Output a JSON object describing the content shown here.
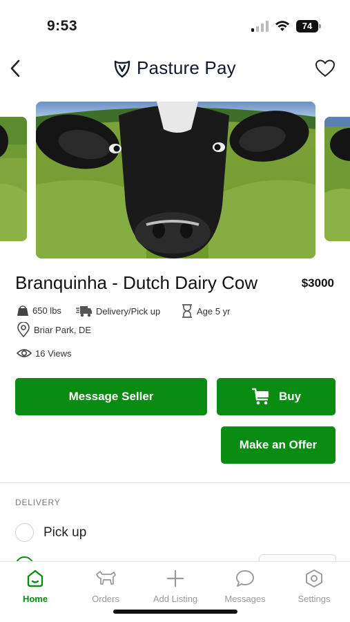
{
  "status_bar": {
    "time": "9:53",
    "battery": "74"
  },
  "header": {
    "brand_name": "Pasture Pay",
    "back_icon": "chevron-left-icon",
    "favorite_icon": "heart-outline-icon",
    "logo_icon": "cow-shield-icon"
  },
  "listing": {
    "title": "Branquinha - Dutch Dairy Cow",
    "price": "$3000",
    "weight": "650 lbs",
    "delivery": "Delivery/Pick up",
    "age": "Age 5 yr",
    "location": "Briar Park, DE",
    "views": "16 Views"
  },
  "actions": {
    "message_seller": "Message Seller",
    "buy": "Buy",
    "make_offer": "Make an Offer"
  },
  "delivery_section": {
    "label": "DELIVERY",
    "options": [
      "Pick up"
    ]
  },
  "tabs": [
    {
      "label": "Home",
      "icon": "home-icon",
      "active": true
    },
    {
      "label": "Orders",
      "icon": "cow-icon",
      "active": false
    },
    {
      "label": "Add Listing",
      "icon": "plus-icon",
      "active": false
    },
    {
      "label": "Messages",
      "icon": "chat-bubble-icon",
      "active": false
    },
    {
      "label": "Settings",
      "icon": "settings-hexagon-icon",
      "active": false
    }
  ],
  "colors": {
    "accent": "#0a8c12",
    "text": "#1a1a1a",
    "muted": "#9a9a9a"
  }
}
